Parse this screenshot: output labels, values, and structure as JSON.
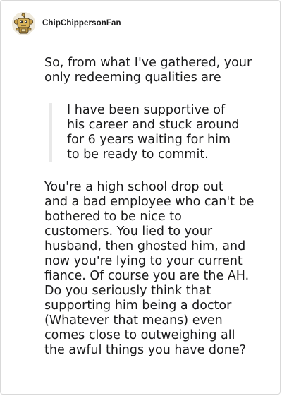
{
  "comment": {
    "author": "ChipChippersonFan",
    "avatar_icon": "reddit-snoo-avatar-icon",
    "intro_lines": [
      "So, from what I've gathered, your",
      "only redeeming qualities are"
    ],
    "quote_lines": [
      "I have been supportive of",
      "his career and stuck around",
      "for 6 years waiting for him",
      "to be ready to commit."
    ],
    "body_lines": [
      "You're a high school drop out",
      "and a bad employee who can't be",
      "bothered to be nice to",
      "customers. You lied to your",
      "husband, then ghosted him, and",
      "now you're lying to your current",
      "fiance. Of course you are the AH.",
      "Do you seriously think that",
      "supporting him being a doctor",
      "(Whatever that means) even",
      "comes close to outweighing all",
      "the awful things you have done?"
    ]
  },
  "colors": {
    "text": "#1a1a1b",
    "border": "#d9d9d9",
    "quote_bar": "#e9e9e9",
    "background": "#ffffff"
  }
}
